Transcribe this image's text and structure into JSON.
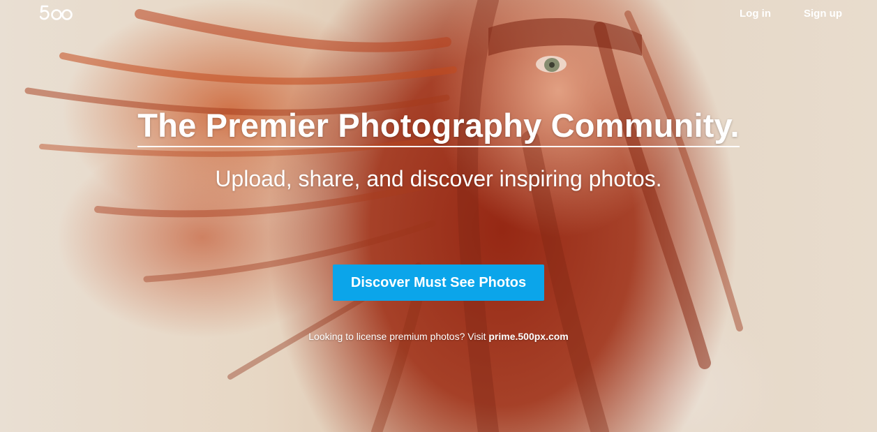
{
  "brand": {
    "logo_text": "500",
    "logo_icon": "500px-logo"
  },
  "nav": {
    "login_label": "Log in",
    "signup_label": "Sign up"
  },
  "hero": {
    "headline": "The Premier Photography Community.",
    "subheadline": "Upload, share, and discover inspiring photos.",
    "cta_label": "Discover Must See Photos",
    "license_text": "Looking to license premium photos? Visit ",
    "license_link": "prime.500px.com",
    "background_image": "red-haired woman with windblown hair"
  },
  "colors": {
    "cta_bg": "#0ba5ea",
    "text": "#ffffff"
  }
}
